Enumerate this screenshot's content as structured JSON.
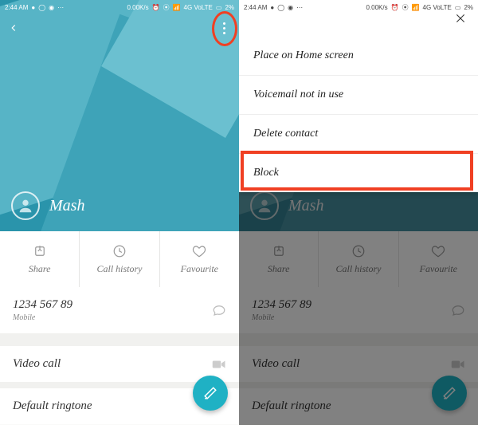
{
  "statusbar": {
    "time": "2:44 AM",
    "net_speed": "0.00K/s",
    "carrier": "4G VoLTE",
    "battery": "2%"
  },
  "contact": {
    "name": "Mash"
  },
  "actions": {
    "share": "Share",
    "call_history": "Call history",
    "favourite": "Favourite"
  },
  "phone_row": {
    "number": "1234 567 89",
    "type": "Mobile"
  },
  "rows": {
    "video_call": "Video call",
    "ringtone": "Default ringtone"
  },
  "menu": {
    "items": [
      "Place on Home screen",
      "Voicemail not in use",
      "Delete contact",
      "Block"
    ]
  }
}
